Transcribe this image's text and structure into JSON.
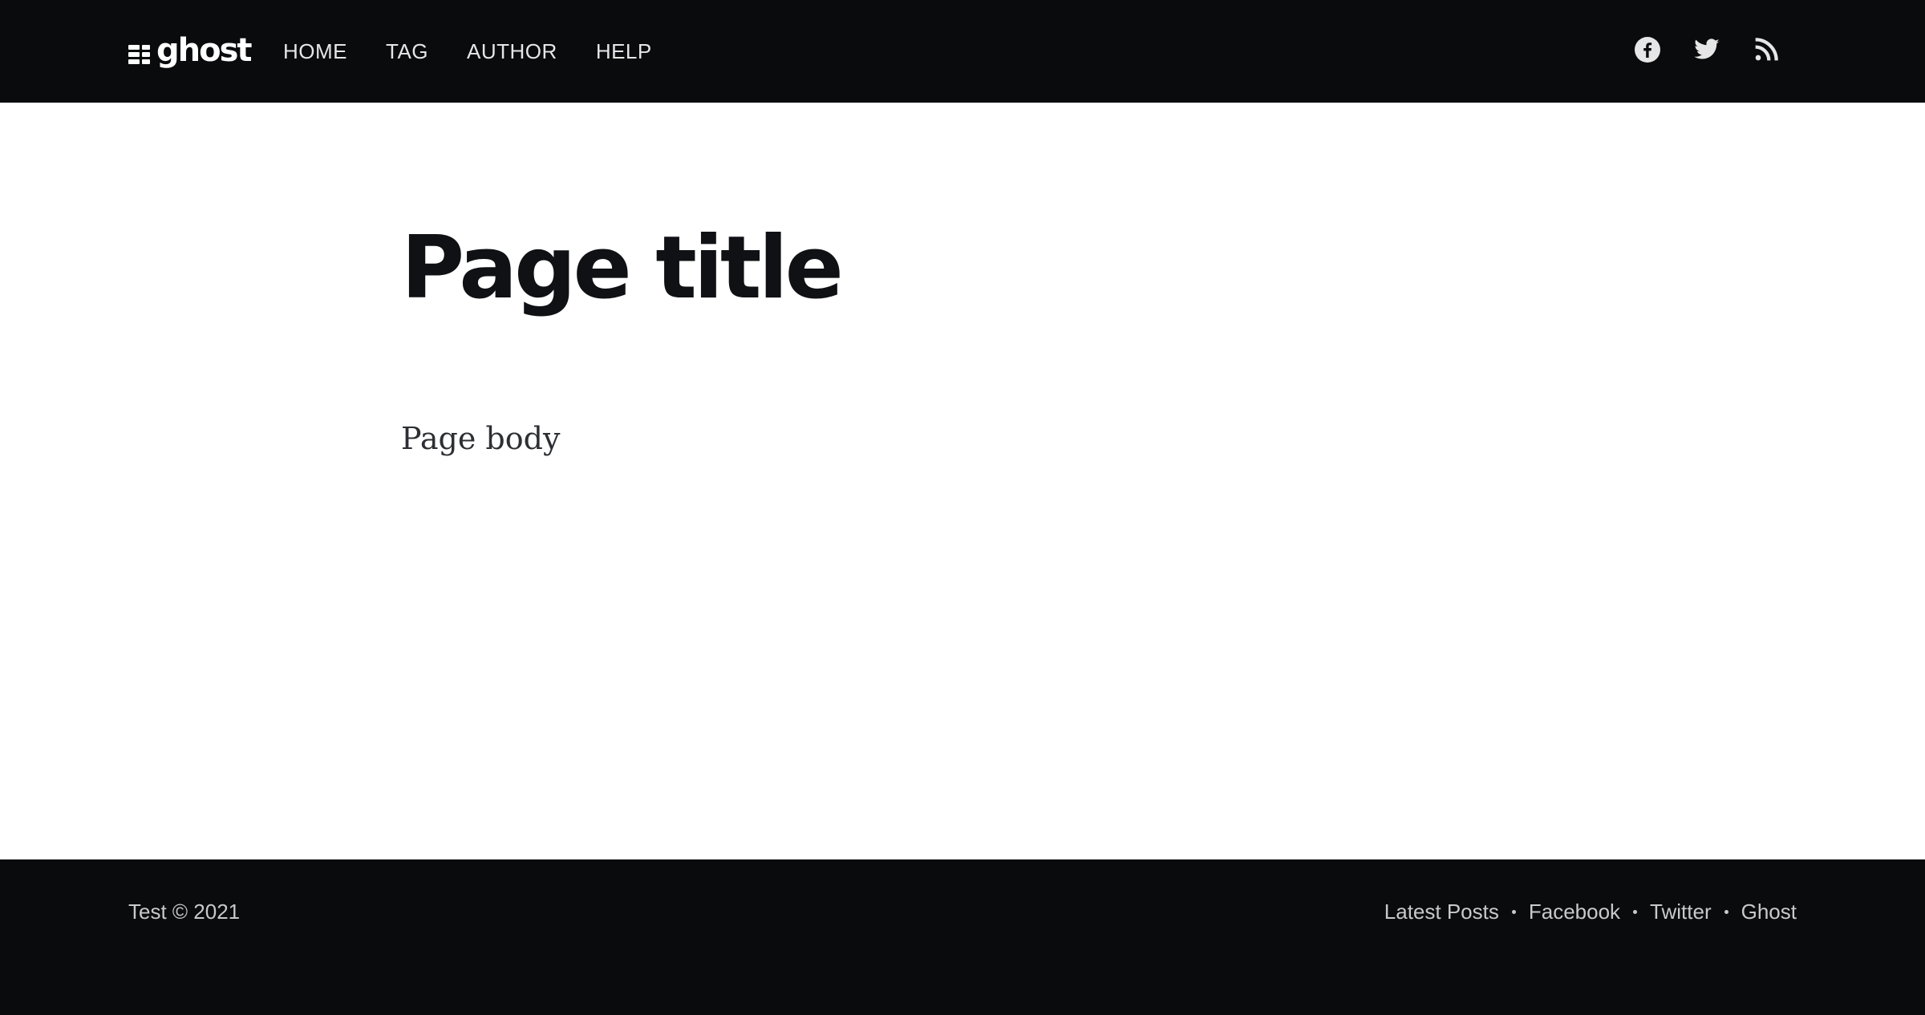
{
  "header": {
    "logo_text": "ghost",
    "nav": [
      {
        "label": "HOME"
      },
      {
        "label": "TAG"
      },
      {
        "label": "AUTHOR"
      },
      {
        "label": "HELP"
      }
    ],
    "social": [
      {
        "icon": "facebook-icon"
      },
      {
        "icon": "twitter-icon"
      },
      {
        "icon": "rss-icon"
      }
    ]
  },
  "main": {
    "title": "Page title",
    "body": "Page body"
  },
  "footer": {
    "copyright": "Test © 2021",
    "links": [
      {
        "label": "Latest Posts"
      },
      {
        "label": "Facebook"
      },
      {
        "label": "Twitter"
      },
      {
        "label": "Ghost"
      }
    ]
  },
  "colors": {
    "header_bg": "#0a0b0d",
    "footer_bg": "#0a0b0d",
    "page_bg": "#ffffff",
    "title": "#0f1114",
    "body_text": "#2d2f33",
    "nav_text": "#e6e6e6",
    "footer_text": "#c7c9cc"
  }
}
